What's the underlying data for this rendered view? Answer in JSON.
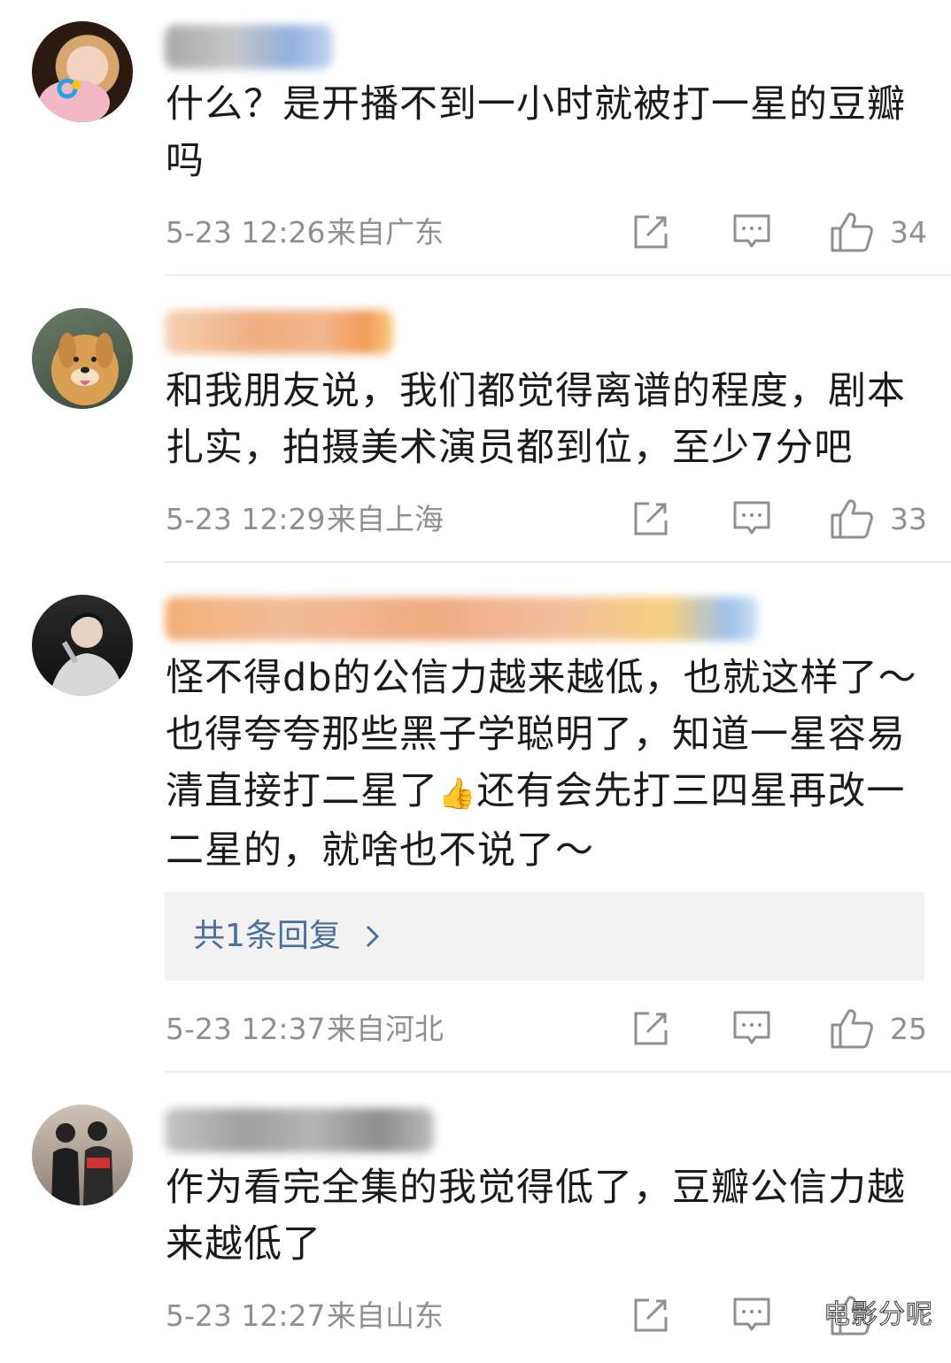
{
  "comments": [
    {
      "text": "什么？是开播不到一小时就被打一星的豆瓣吗",
      "time": "5-23 12:26",
      "location": "来自广东",
      "likes": "34"
    },
    {
      "text": "和我朋友说，我们都觉得离谱的程度，剧本扎实，拍摄美术演员都到位，至少7分吧",
      "time": "5-23 12:29",
      "location": "来自上海",
      "likes": "33"
    },
    {
      "text_part1": "怪不得db的公信力越来越低，也就这样了～也得夸夸那些黑子学聪明了，知道一星容易清直接打二星了",
      "emoji": "👍",
      "text_part2": "还有会先打三四星再改一二星的，就啥也不说了～",
      "reply_link": "共1条回复",
      "time": "5-23 12:37",
      "location": "来自河北",
      "likes": "25"
    },
    {
      "text": "作为看完全集的我觉得低了，豆瓣公信力越来越低了",
      "time": "5-23 12:27",
      "location": "来自山东",
      "likes": ""
    }
  ],
  "watermark": "电影分呢",
  "icons": {
    "share": "share-icon",
    "reply": "comment-icon",
    "like": "thumbs-up-icon"
  },
  "colors": {
    "text": "#1a1a1a",
    "meta": "#8f8f8f",
    "link": "#4a6fa0",
    "reply_bg": "#f2f2f2"
  }
}
